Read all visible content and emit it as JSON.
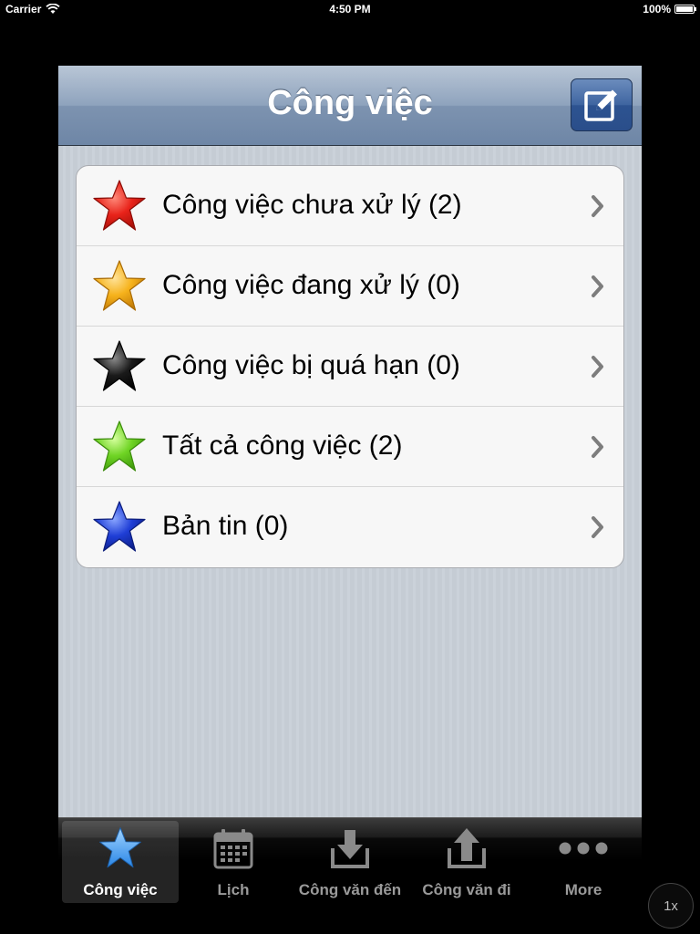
{
  "status_bar": {
    "carrier": "Carrier",
    "time": "4:50 PM",
    "battery": "100%"
  },
  "navbar": {
    "title": "Công việc",
    "compose_icon": "compose-icon"
  },
  "menu": {
    "items": [
      {
        "label": "Công việc chưa xử lý (2)",
        "star_color": "#e8231a",
        "icon": "red-star-icon"
      },
      {
        "label": "Công việc đang xử lý (0)",
        "star_color": "#f6b21b",
        "icon": "orange-star-icon"
      },
      {
        "label": "Công việc bị quá hạn (0)",
        "star_color": "#1a1a1a",
        "icon": "black-star-icon"
      },
      {
        "label": "Tất cả công việc (2)",
        "star_color": "#6fd424",
        "icon": "green-star-icon"
      },
      {
        "label": "Bản tin (0)",
        "star_color": "#1f3ed6",
        "icon": "blue-star-icon"
      }
    ]
  },
  "tabbar": {
    "tabs": [
      {
        "label": "Công việc",
        "icon": "star-icon",
        "active": true
      },
      {
        "label": "Lịch",
        "icon": "calendar-icon",
        "active": false
      },
      {
        "label": "Công văn đến",
        "icon": "inbox-download-icon",
        "active": false
      },
      {
        "label": "Công văn đi",
        "icon": "outbox-upload-icon",
        "active": false
      },
      {
        "label": "More",
        "icon": "more-dots-icon",
        "active": false
      }
    ]
  },
  "zoom_button": "1x"
}
